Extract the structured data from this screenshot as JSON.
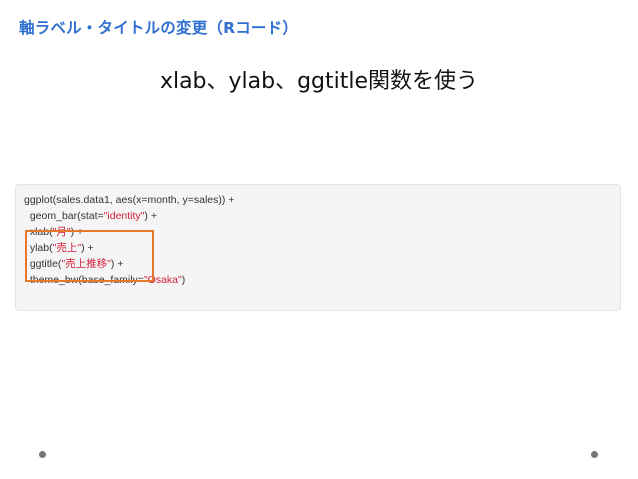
{
  "slide": {
    "heading": "軸ラベル・タイトルの変更（Rコード）",
    "subtitle": "xlab、ylab、ggtitle関数を使う"
  },
  "code": {
    "line1": "ggplot(sales.data1, aes(x=month, y=sales)) +",
    "line2_pre": "  geom_bar(stat=",
    "line2_str": "\"identity\"",
    "line2_post": ") +",
    "line3_pre": "  xlab(",
    "line3_str": "\"月\"",
    "line3_post": ") +",
    "line4_pre": "  ylab(",
    "line4_str": "\"売上\"",
    "line4_post": ") +",
    "line5_pre": "  ggtitle(",
    "line5_str": "\"売上推移\"",
    "line5_post": ") +",
    "line6_pre": "  theme_bw(base_family=",
    "line6_str": "\"Osaka\"",
    "line6_post": ")"
  },
  "colors": {
    "heading": "#2f6fd0",
    "string": "#d2203c",
    "highlight_border": "#e8772e"
  }
}
